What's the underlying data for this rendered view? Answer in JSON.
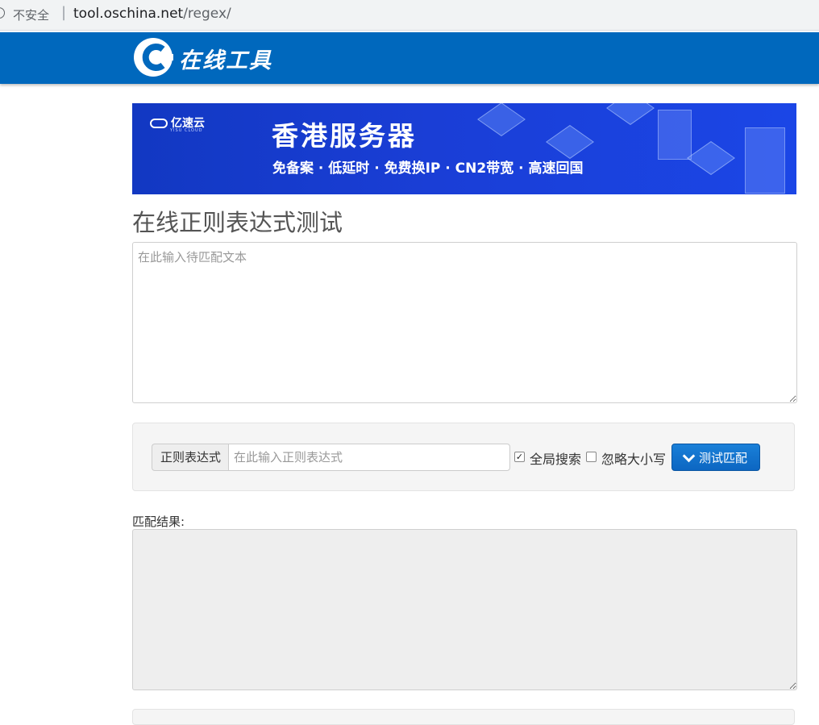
{
  "browser": {
    "security_label": "不安全",
    "separator": "|",
    "url_host": "tool.oschina.net",
    "url_path": "/regex/"
  },
  "header": {
    "logo_text": "在线工具",
    "brand_color": "#0068bd"
  },
  "banner": {
    "brand": "亿速云",
    "brand_sub": "YISU CLOUD",
    "headline": "香港服务器",
    "tagline": "免备案 · 低延时 · 免费换IP · CN2带宽 · 高速回国"
  },
  "main": {
    "title": "在线正则表达式测试",
    "text_placeholder": "在此输入待匹配文本",
    "regex_addon": "正则表达式",
    "regex_placeholder": "在此输入正则表达式",
    "global_search": {
      "label": "全局搜索",
      "checked": true
    },
    "ignore_case": {
      "label": "忽略大小写",
      "checked": false
    },
    "test_button": "测试匹配",
    "result_label": "匹配结果:",
    "accent_color": "#0c66c2"
  }
}
